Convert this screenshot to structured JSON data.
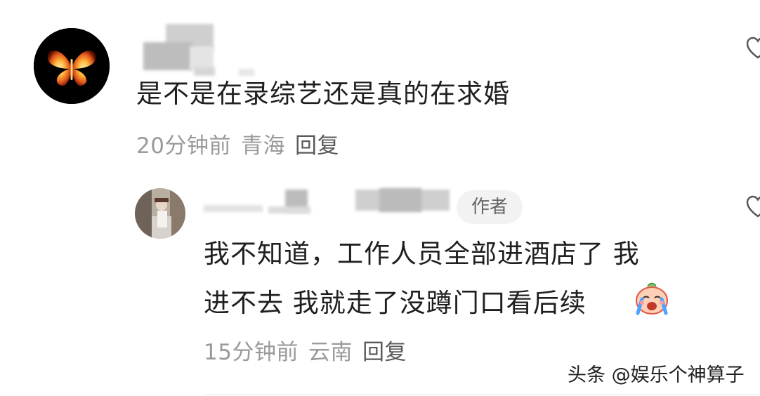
{
  "comment": {
    "text": "是不是在录综艺还是真的在求婚",
    "time": "20分钟前",
    "location": "青海",
    "reply_label": "回复"
  },
  "reply": {
    "badge": "作者",
    "text_line1": "我不知道，工作人员全部进酒店了 我",
    "text_line2": "进不去 我就走了没蹲门口看后续",
    "emoji_icon": "crying-face-emoji-icon",
    "time": "15分钟前",
    "location": "云南",
    "reply_label": "回复"
  },
  "watermark": "头条 @娱乐个神算子",
  "colors": {
    "meta": "#9a9a9a",
    "badge_bg": "#f2f2f2",
    "text": "#1f1f1f"
  }
}
